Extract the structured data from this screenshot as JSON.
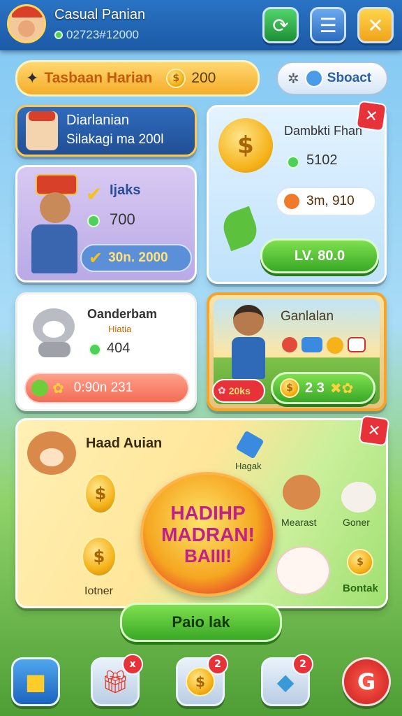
{
  "header": {
    "title": "Casual Panian",
    "subtitle": "02723#12000",
    "icons": [
      "refresh-icon",
      "list-icon",
      "close-icon"
    ]
  },
  "daily": {
    "label": "Tasbaan Harian",
    "value": "200"
  },
  "shop_button": {
    "label": "Sboact"
  },
  "profile_card": {
    "title": "Diarlanian",
    "subtitle": "Silakagi ma 200l"
  },
  "card_hero": {
    "title": "Ijaks",
    "gems": "700",
    "action": "30n. 2000"
  },
  "card_bear": {
    "title": "Oanderbam",
    "tag": "Hiatia",
    "gems": "404",
    "timer": "0:90n 231"
  },
  "card_reward": {
    "title": "Dambkti Fhan",
    "gems": "5102",
    "cost": "3m, 910",
    "button": "LV. 80.0"
  },
  "card_scene": {
    "title": "Ganlalan",
    "badge": "20ks",
    "stats": "2 3"
  },
  "event": {
    "title": "Haad Auian",
    "banner": [
      "HADIHP",
      "MADRAN!",
      "BAIII!"
    ],
    "labels": [
      "Hagak",
      "Mearast",
      "Goner",
      "Iotner",
      "Bontak"
    ],
    "button": "Paio lak"
  },
  "nav": {
    "badges": [
      "x",
      "2",
      "2"
    ]
  },
  "colors": {
    "accent": "#39a826",
    "header": "#1b5aa6",
    "alert": "#e8323a",
    "gold": "#f5b219"
  }
}
